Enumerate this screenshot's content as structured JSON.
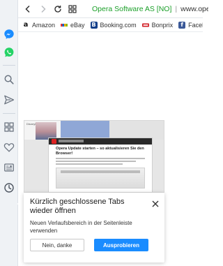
{
  "toolbar": {
    "address": {
      "site_name": "Opera Software AS [NO]",
      "url_text": "www.opera."
    }
  },
  "bookmarks": [
    {
      "label": "Amazon",
      "icon": "amazon-icon",
      "color": "#111111"
    },
    {
      "label": "eBay",
      "icon": "ebay-icon",
      "color": "#e53238"
    },
    {
      "label": "Booking.com",
      "icon": "booking-icon",
      "color": "#123f8a"
    },
    {
      "label": "Bonprix",
      "icon": "bonprix-icon",
      "color": "#d1232a"
    },
    {
      "label": "Faceboo",
      "icon": "facebook-icon",
      "color": "#3b5998"
    }
  ],
  "sidebar": {
    "items": [
      {
        "name": "messenger-icon"
      },
      {
        "name": "whatsapp-icon"
      },
      {
        "name": "search-icon"
      },
      {
        "name": "send-icon"
      },
      {
        "name": "speed-dial-icon"
      },
      {
        "name": "heart-icon"
      },
      {
        "name": "news-icon"
      },
      {
        "name": "history-icon"
      }
    ]
  },
  "preview": {
    "brand": "Disneyland",
    "article_title": "Opera Update starten – so aktualisieren Sie den Browser!"
  },
  "popup": {
    "title": "Kürzlich geschlossene Tabs wieder öffnen",
    "text": "Neuen Verlaufsbereich in der Seitenleiste verwenden",
    "secondary_label": "Nein, danke",
    "primary_label": "Ausprobieren"
  },
  "colors": {
    "accent": "#1a8cff",
    "secure": "#1a9f28",
    "sidebar_bg": "#eff2f5"
  }
}
